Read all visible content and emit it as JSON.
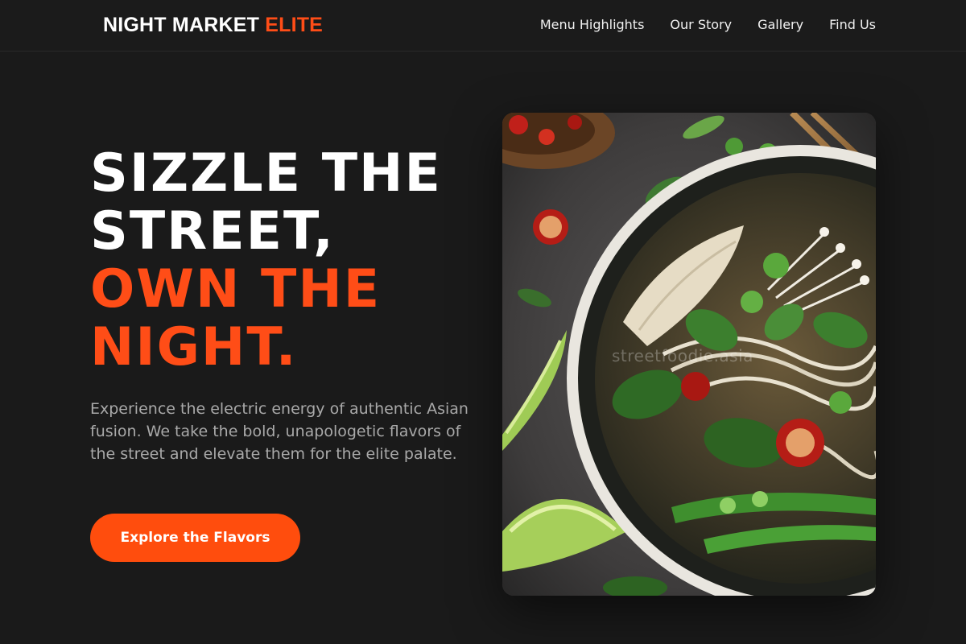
{
  "brand": {
    "name": "NIGHT MARKET",
    "accent": "ELITE",
    "accent_color": "#ff4d17"
  },
  "nav": {
    "items": [
      {
        "label": "Menu Highlights"
      },
      {
        "label": "Our Story"
      },
      {
        "label": "Gallery"
      },
      {
        "label": "Find Us"
      }
    ]
  },
  "hero": {
    "headline_line1": "SIZZLE THE",
    "headline_line2": "STREET,",
    "headline_line3": "OWN THE",
    "headline_line4": "NIGHT.",
    "description": "Experience the electric energy of authentic Asian fusion. We take the bold, unapologetic flavors of the street and elevate them for the elite palate.",
    "cta_label": "Explore the Flavors",
    "image_watermark": "streetfoodie.asia",
    "image_subject": "noodle-soup-bowl-photo"
  },
  "colors": {
    "background": "#1a1a1a",
    "accent": "#ff4d17",
    "text_muted": "#a9a9a9"
  }
}
